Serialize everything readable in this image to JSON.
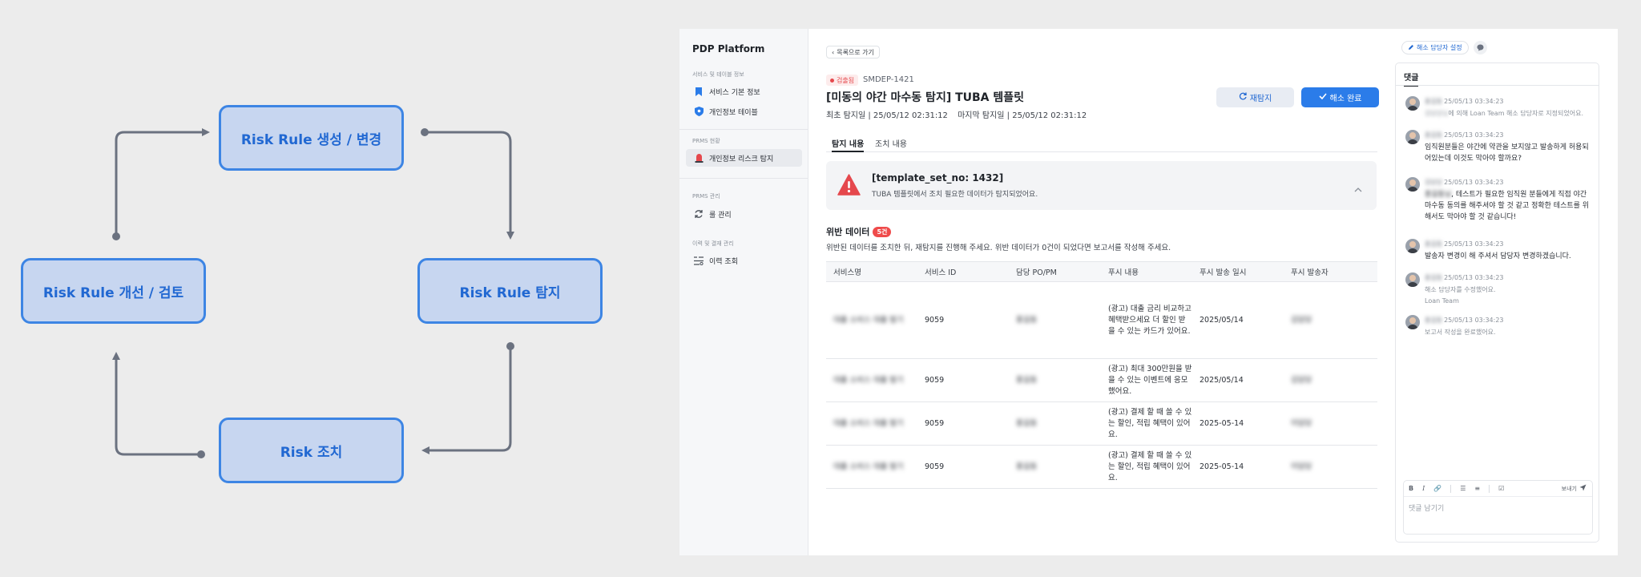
{
  "diagram": {
    "top": "Risk Rule 생성 / 변경",
    "right": "Risk Rule 탐지",
    "bottom": "Risk 조치",
    "left": "Risk Rule 개선 / 검토"
  },
  "sidebar": {
    "brand": "PDP Platform",
    "groups": [
      {
        "label": "서비스 및 테이블 정보",
        "items": [
          {
            "label": "서비스 기본 정보",
            "icon": "bookmark-icon"
          },
          {
            "label": "개인정보 테이블",
            "icon": "shield-icon"
          }
        ]
      },
      {
        "label": "PRMS 현황",
        "items": [
          {
            "label": "개인정보 리스크 탐지",
            "icon": "siren-icon"
          }
        ]
      },
      {
        "label": "PRMS 관리",
        "items": [
          {
            "label": "룰 관리",
            "icon": "refresh-icon"
          }
        ]
      },
      {
        "label": "이력 및 결재 관리",
        "items": [
          {
            "label": "이력 조회",
            "icon": "list-icon"
          }
        ]
      }
    ]
  },
  "header": {
    "back": "목록으로 가기",
    "status": "검출됨",
    "ticket_id": "SMDEP-1421",
    "title": "[미동의 야간 마수동 탐지] TUBA 템플릿",
    "first_detected": "최초 탐지일 | 25/05/12 02:31:12",
    "last_detected": "마지막 탐지일 | 25/05/12 02:31:12",
    "redetect": "재탐지",
    "resolve": "해소 완료"
  },
  "tabs": [
    "탐지 내용",
    "조치 내용"
  ],
  "alert": {
    "title": "[template_set_no: 1432]",
    "desc": "TUBA 템플릿에서 조치 필요한 데이터가 탐지되었어요."
  },
  "violation": {
    "title": "위반 데이터",
    "count": "5건",
    "desc": "위반된 데이터를 조치한 뒤, 재탐지를 진행해 주세요. 위반 데이터가 0건이 되었다면 보고서를 작성해 주세요."
  },
  "table": {
    "columns": [
      "서비스명",
      "서비스 ID",
      "담당 PO/PM",
      "푸시 내용",
      "푸시 발송 일시",
      "푸시 발송자"
    ],
    "rows": [
      {
        "service": "대출 소비스 대출 발기",
        "id": "9059",
        "owner": "홍길동",
        "push": "(광고) 대출 금리 비교하고 혜택받으세요 더 할인 받을 수 있는 카드가 있어요.",
        "date": "2025/05/14",
        "sender": "김담당"
      },
      {
        "service": "대출 소비스 대출 발기",
        "id": "9059",
        "owner": "홍길동",
        "push": "(광고) 최대 300만원을 받을 수 있는 이벤트에 응모했어요.",
        "date": "2025/05/14",
        "sender": "김담당"
      },
      {
        "service": "대출 소비스 대출 발기",
        "id": "9059",
        "owner": "홍길동",
        "push": "(광고) 결제 할 때 쓸 수 있는 할인, 적립 혜택이 있어요.",
        "date": "2025-05-14",
        "sender": "이담당"
      },
      {
        "service": "대출 소비스 대출 발기",
        "id": "9059",
        "owner": "홍길동",
        "push": "(광고) 결제 할 때 쓸 수 있는 할인, 적립 혜택이 있어요.",
        "date": "2025-05-14",
        "sender": "이담당"
      }
    ]
  },
  "top_actions": {
    "assign": "해소 담당자 설정"
  },
  "comments": {
    "tab": "댓글",
    "items": [
      {
        "name": "홍길동",
        "time": "25/05/13 03:34:23",
        "text_blur": "김담당님",
        "text": "에 의해 Loan Team 해소 담당자로 지정되었어요."
      },
      {
        "name": "홍길동",
        "time": "25/05/13 03:34:23",
        "text": "임직원분들은 야간에 약관을 보지않고 발송하게 허용되어있는데 이것도 막아야 할까요?"
      },
      {
        "name": "김담당",
        "time": "25/05/13 03:34:23",
        "text_blur": "홍길동님",
        "text": ", 테스트가 필요한 임직원 분들에게 직접 야간 마수동 동의를 해주셔야 할 것 같고 정확한 테스트를 위해서도 막아야 할 것 같습니다!"
      },
      {
        "name": "홍길동",
        "time": "25/05/13 03:34:23",
        "text": "발송자 변경이 해 주셔서 담당자 변경하겠습니다."
      },
      {
        "name": "홍길동",
        "time": "25/05/13 03:34:23",
        "text": "해소 담당자를 수정했어요.",
        "sub": "Loan Team"
      },
      {
        "name": "홍길동",
        "time": "25/05/13 03:34:23",
        "text": "보고서 작성을 완료했어요."
      }
    ],
    "send": "보내기",
    "placeholder": "댓글 남기기"
  }
}
